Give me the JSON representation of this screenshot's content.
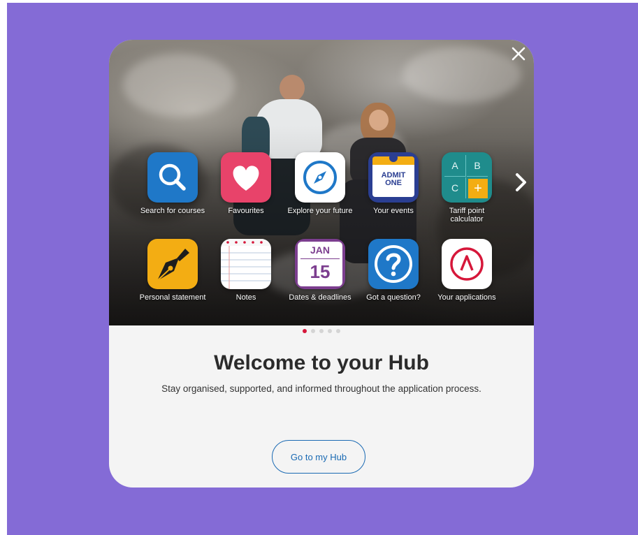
{
  "modal": {
    "title": "Welcome to your Hub",
    "subtitle": "Stay organised, supported, and informed throughout the application process.",
    "cta_label": "Go to my Hub"
  },
  "apps": [
    {
      "label": "Search for courses",
      "icon": "search-icon",
      "color": "#1f78c8"
    },
    {
      "label": "Favourites",
      "icon": "heart-icon",
      "color": "#e8436a"
    },
    {
      "label": "Explore your future",
      "icon": "compass-icon",
      "color": "#ffffff"
    },
    {
      "label": "Your events",
      "icon": "ticket-icon",
      "color": "#2a3e92",
      "ticket_text": "ADMIT ONE"
    },
    {
      "label": "Tariff point calculator",
      "icon": "calculator-icon",
      "color": "#1f8c8c",
      "keys": [
        "A",
        "B",
        "C",
        "+"
      ]
    },
    {
      "label": "Personal statement",
      "icon": "pen-nib-icon",
      "color": "#f3ad13"
    },
    {
      "label": "Notes",
      "icon": "notepad-icon",
      "color": "#ffffff"
    },
    {
      "label": "Dates & deadlines",
      "icon": "calendar-icon",
      "color": "#7c3e8f",
      "month": "JAN",
      "day": "15"
    },
    {
      "label": "Got a question?",
      "icon": "question-icon",
      "color": "#1f78c8"
    },
    {
      "label": "Your applications",
      "icon": "applications-logo-icon",
      "color": "#ffffff"
    }
  ],
  "pagination": {
    "count": 5,
    "active": 1
  },
  "colors": {
    "backdrop": "#846bd6",
    "accent": "#1a6ab3",
    "active_dot": "#d6173a"
  }
}
